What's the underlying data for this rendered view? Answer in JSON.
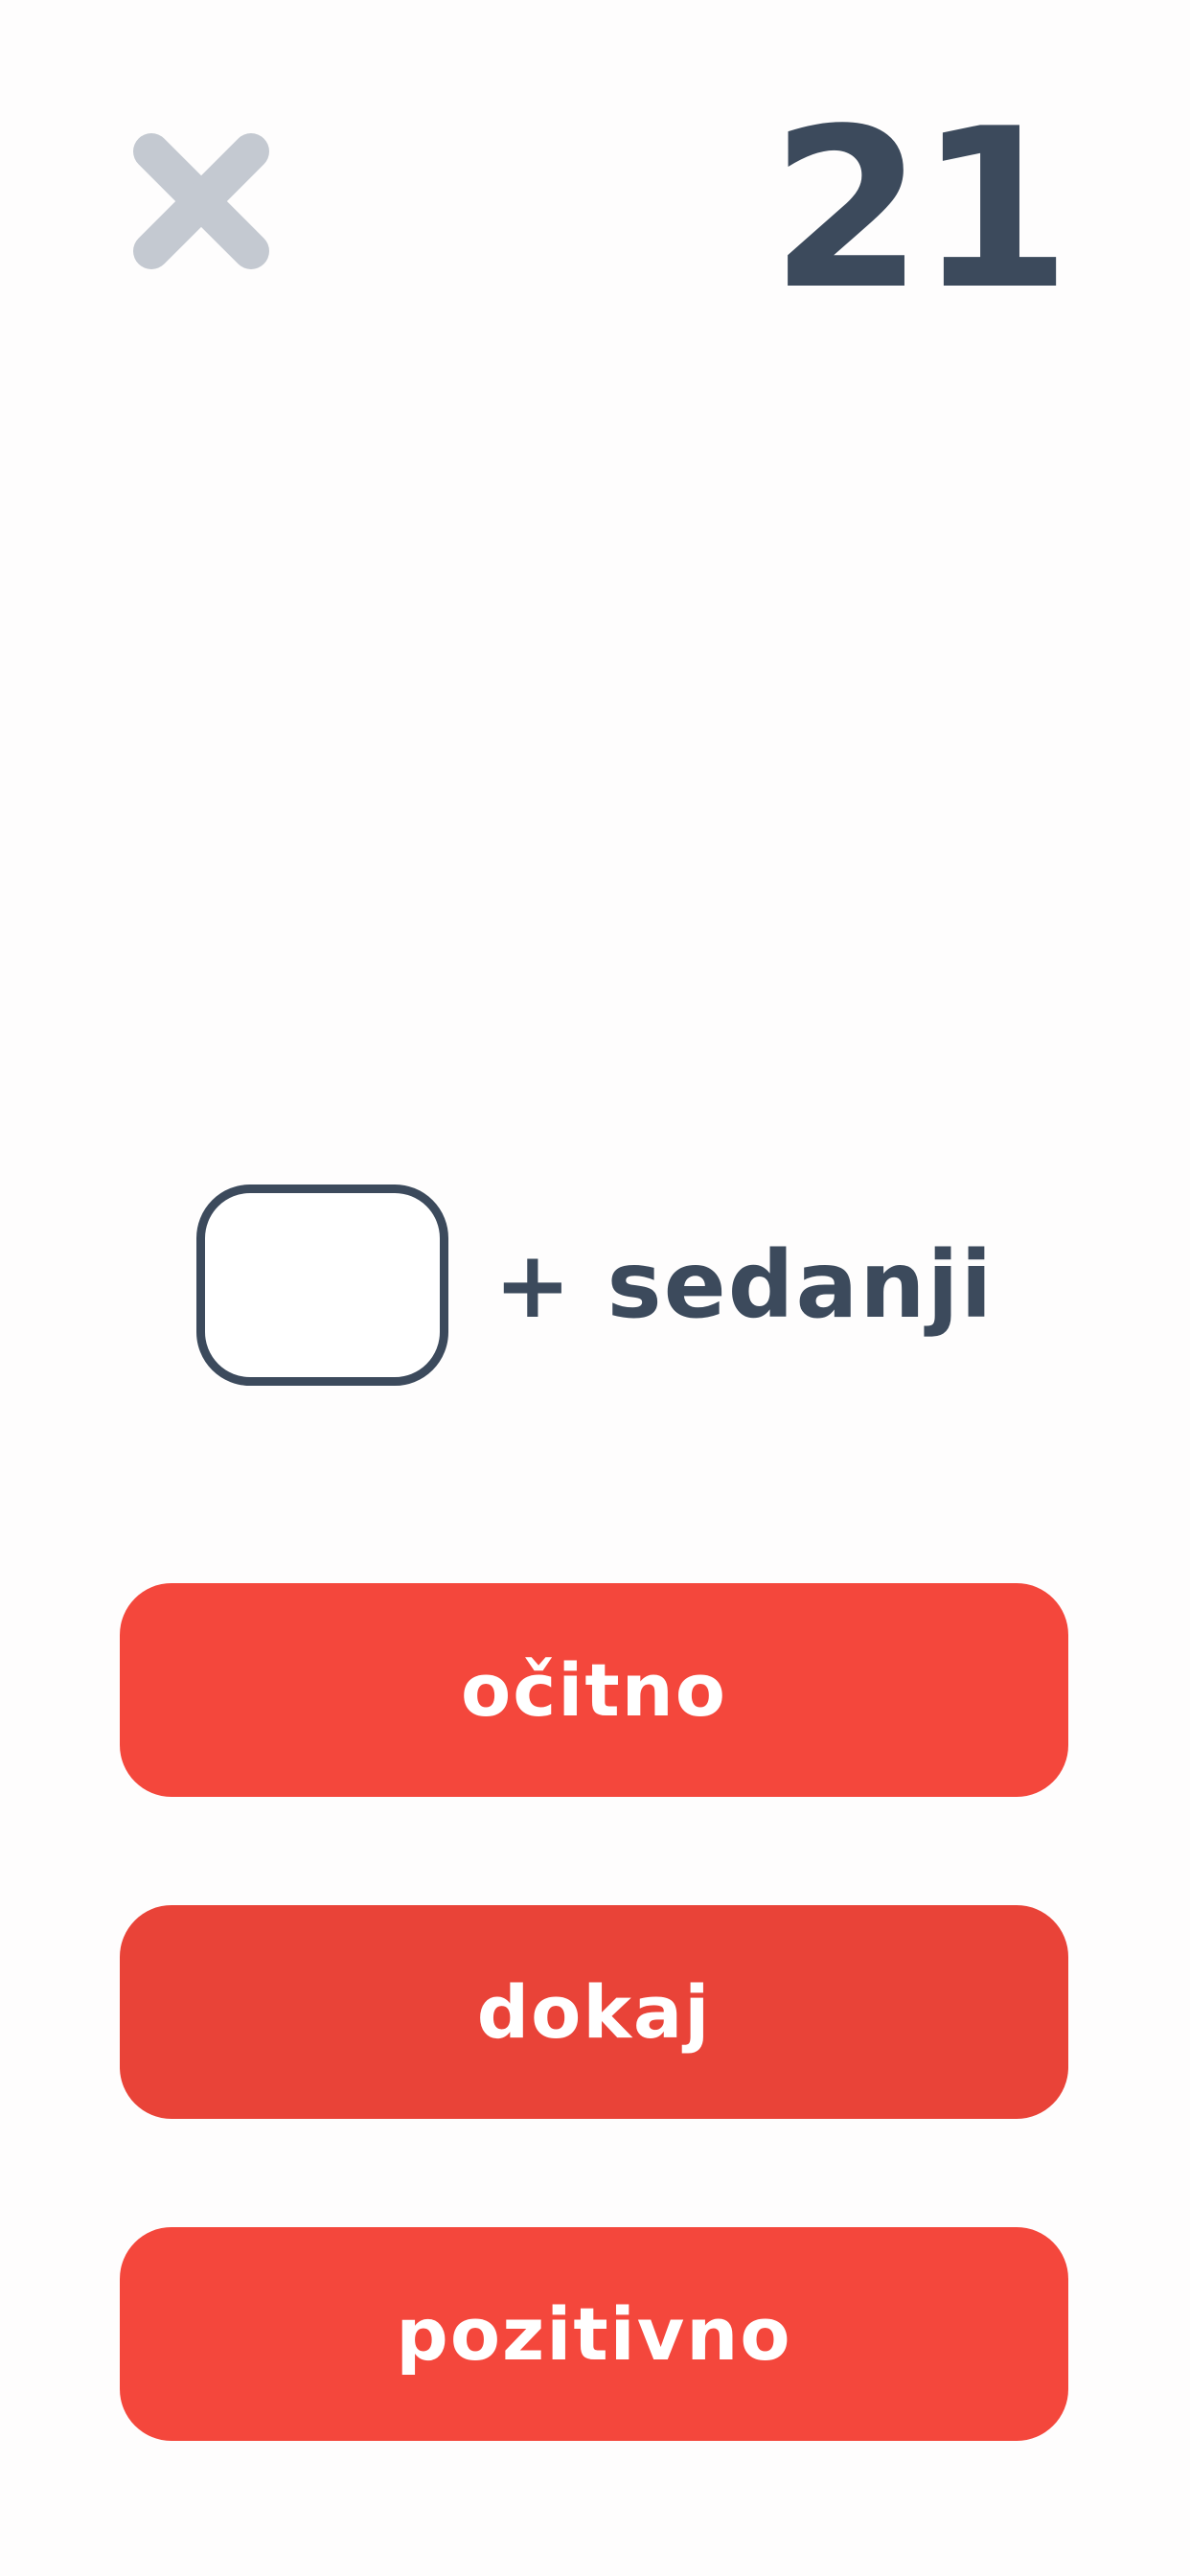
{
  "header": {
    "close_icon": "close-x-icon",
    "close_color": "#c4c9d1",
    "counter": "21"
  },
  "question": {
    "blank": "",
    "suffix": "+ sedanji"
  },
  "answers": [
    {
      "label": "očitno",
      "color": "#f4473c"
    },
    {
      "label": "dokaj",
      "color": "#e94338"
    },
    {
      "label": "pozitivno",
      "color": "#f4473c"
    }
  ]
}
